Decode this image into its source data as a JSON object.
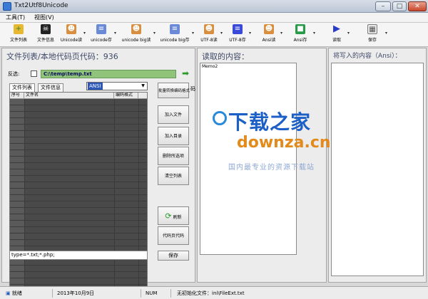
{
  "window": {
    "title": "Txt2Utf8Unicode",
    "controls": {
      "minimize": "–",
      "maximize": "□",
      "close": "✕"
    }
  },
  "menu": [
    {
      "label": "工具(T)"
    },
    {
      "label": "视图(V)"
    }
  ],
  "toolbar": [
    {
      "label": "文件列表",
      "icon": "folder-add-icon",
      "color": "#e8b830"
    },
    {
      "label": "文件信息",
      "icon": "skull-icon",
      "color": "#222222"
    },
    {
      "label": "Unicode读",
      "icon": "person-icon",
      "color": "#d89040"
    },
    {
      "label": "unicode存",
      "icon": "doc-icon",
      "color": "#6a8ad8"
    },
    {
      "label": "unicode big读",
      "icon": "person-icon",
      "color": "#d89040"
    },
    {
      "label": "unicode big存",
      "icon": "doc-icon",
      "color": "#6a8ad8"
    },
    {
      "label": "UTF-8读",
      "icon": "person-icon",
      "color": "#d89040"
    },
    {
      "label": "UTF-8存",
      "icon": "doc-icon",
      "color": "#3a4ad8"
    },
    {
      "label": "Ansi读",
      "icon": "person-icon",
      "color": "#d89040"
    },
    {
      "label": "Ansi存",
      "icon": "green-square-icon",
      "color": "#2a9a4a"
    },
    {
      "label": "读取",
      "icon": "play-icon",
      "color": "#2a3ac8"
    },
    {
      "label": "保存",
      "icon": "table-icon",
      "color": "#7a7a7a"
    }
  ],
  "left_panel": {
    "title": "文件列表/本地代码页代码：936",
    "recurse_label": "反选:",
    "path": "C:\\temp\\temp.txt",
    "tabs": [
      "文件列表",
      "文件信息"
    ],
    "encoding_selected": "ANSI",
    "grid_headers": [
      "序号",
      "文件名",
      "编码格式"
    ],
    "side_buttons": {
      "batch_convert": "批量转换编码格式",
      "batch_label": "码",
      "add_file": "加入文件",
      "add_dir": "加入目录",
      "remove_selected": "删除所选项",
      "clear_list": "清空列表",
      "refresh": "刷新",
      "codepage": "代码页代码"
    },
    "filter_value": "type=*.txt;*.php;",
    "save_label": "保存"
  },
  "middle_panel": {
    "title": "读取的内容：",
    "memo_text": "Memo2"
  },
  "right_panel": {
    "title": "将写入的内容（Ansi）："
  },
  "watermark": {
    "cn": "下载之家",
    "en": "downza.cn",
    "sub": "国内最专业的资源下载站"
  },
  "status": {
    "state": "就绪",
    "date": "2013年10月9日",
    "num": "NUM",
    "message": "无初始化文件：ini\\FileExt.txt"
  }
}
